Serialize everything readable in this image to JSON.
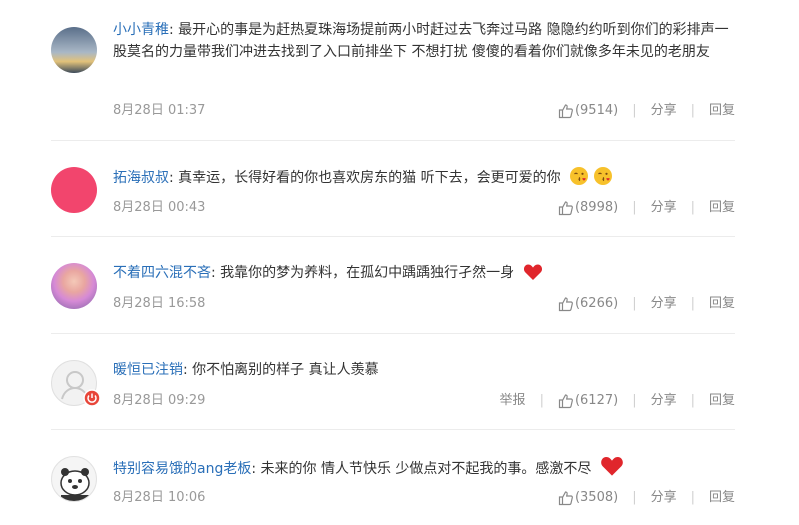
{
  "comments": [
    {
      "user": "小小青稚",
      "text": "最开心的事是为赶热夏珠海场提前两小时赶过去飞奔过马路 隐隐约约听到你们的彩排声一股莫名的力量带我们冲进去找到了入口前排坐下 不想打扰 傻傻的看着你们就像多年未见的老朋友",
      "time": "8月28日 01:37",
      "likes": "(9514)",
      "share": "分享",
      "reply": "回复"
    },
    {
      "user": "拓海叔叔",
      "text": "真幸运，长得好看的你也喜欢房东的猫 听下去，会更可爱的你",
      "time": "8月28日 00:43",
      "likes": "(8998)",
      "share": "分享",
      "reply": "回复",
      "emoji": [
        "kiss-face",
        "kiss-face"
      ]
    },
    {
      "user": "不着四六混不吝",
      "text": "我靠你的梦为养料，在孤幻中踽踽独行孑然一身",
      "time": "8月28日 16:58",
      "likes": "(6266)",
      "share": "分享",
      "reply": "回复",
      "emoji": [
        "red-heart"
      ]
    },
    {
      "user": "暖恒已注销",
      "text": "你不怕离别的样子 真让人羡慕",
      "time": "8月28日 09:29",
      "report": "举报",
      "likes": "(6127)",
      "share": "分享",
      "reply": "回复"
    },
    {
      "user": "特别容易饿的ang老板",
      "text": "未来的你 情人节快乐 少做点对不起我的事。感激不尽",
      "time": "8月28日 10:06",
      "likes": "(3508)",
      "share": "分享",
      "reply": "回复",
      "emoji": [
        "red-heart"
      ]
    }
  ],
  "colors": {
    "link": "#2a6fb8",
    "meta": "#999999",
    "heart": "#e0262c"
  }
}
